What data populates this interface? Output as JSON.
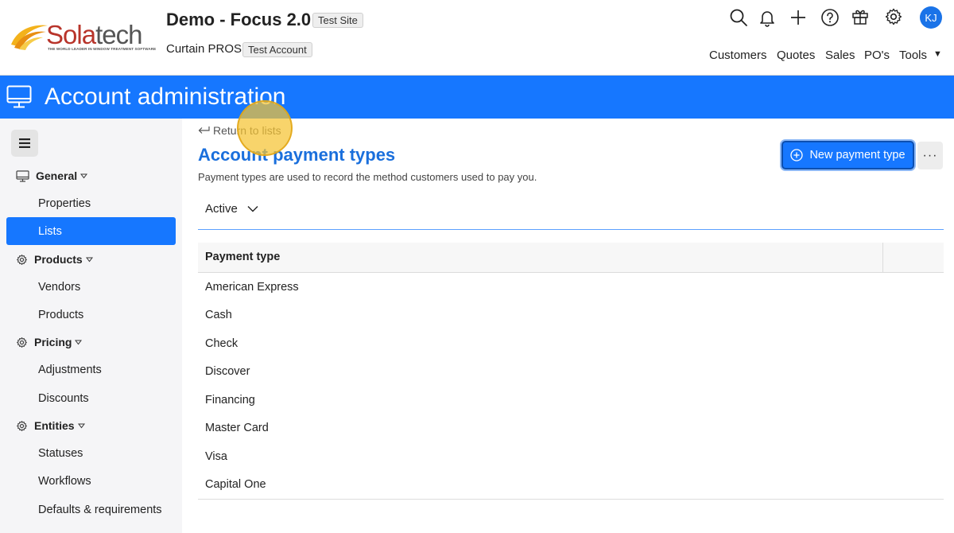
{
  "header": {
    "logo": {
      "brand_left": "Sola",
      "brand_right": "tech",
      "tagline": "THE WORLD LEADER IN WINDOW TREATMENT SOFTWARE"
    },
    "site_title": "Demo - Focus 2.0",
    "site_badge": "Test Site",
    "account_name": "Curtain PROS",
    "account_badge": "Test Account",
    "icons": [
      "search-icon",
      "bell-icon",
      "plus-icon",
      "help-icon",
      "gift-icon",
      "gear-icon"
    ],
    "avatar_initials": "KJ",
    "nav": [
      "Customers",
      "Quotes",
      "Sales",
      "PO's",
      "Tools"
    ],
    "nav_dropdown_glyph": "▼"
  },
  "banner": {
    "title": "Account administration",
    "icon": "monitor-icon",
    "color": "#1677ff"
  },
  "sidebar": {
    "menu_icon": "hamburger-icon",
    "groups": [
      {
        "label": "General",
        "icon": "monitor-icon",
        "items": [
          "Properties",
          "Lists"
        ]
      },
      {
        "label": "Products",
        "icon": "gear-icon",
        "items": [
          "Vendors",
          "Products"
        ]
      },
      {
        "label": "Pricing",
        "icon": "gear-icon",
        "items": [
          "Adjustments",
          "Discounts"
        ]
      },
      {
        "label": "Entities",
        "icon": "gear-icon",
        "items": [
          "Statuses",
          "Workflows",
          "Defaults & requirements"
        ]
      }
    ],
    "active_item": "Lists"
  },
  "main": {
    "return_link": "Return to lists",
    "title": "Account payment types",
    "description": "Payment types are used to record the method customers used to pay you.",
    "new_button": "New payment type",
    "more_button": "···",
    "filter_value": "Active",
    "table": {
      "column_header": "Payment type",
      "rows": [
        "American Express",
        "Cash",
        "Check",
        "Discover",
        "Financing",
        "Master Card",
        "Visa",
        "Capital One"
      ]
    }
  },
  "colors": {
    "accent": "#1677ff",
    "title_blue": "#1a6fdc",
    "brand_red": "#b8342a",
    "sidebar_bg": "#f5f5f7"
  }
}
